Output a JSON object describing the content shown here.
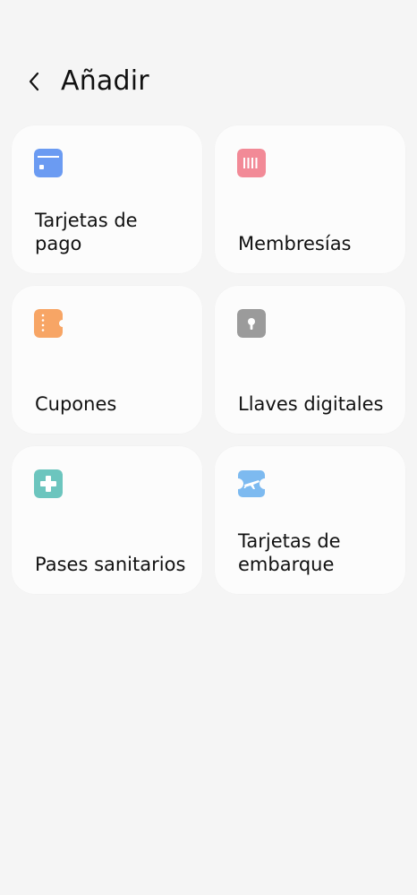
{
  "header": {
    "title": "Añadir",
    "back_icon": "chevron-left-icon"
  },
  "cards": [
    {
      "label": "Tarjetas de pago",
      "icon": "payment-card-icon",
      "color": "#6B9BF2"
    },
    {
      "label": "Membresías",
      "icon": "membership-barcode-icon",
      "color": "#F28A97"
    },
    {
      "label": "Cupones",
      "icon": "coupon-ticket-icon",
      "color": "#F7A565"
    },
    {
      "label": "Llaves digitales",
      "icon": "digital-key-icon",
      "color": "#9B9B9B"
    },
    {
      "label": "Pases sanitarios",
      "icon": "health-cross-icon",
      "color": "#6CC5BE"
    },
    {
      "label": "Tarjetas de embarque",
      "icon": "boarding-pass-plane-icon",
      "color": "#7DBAF0"
    }
  ]
}
